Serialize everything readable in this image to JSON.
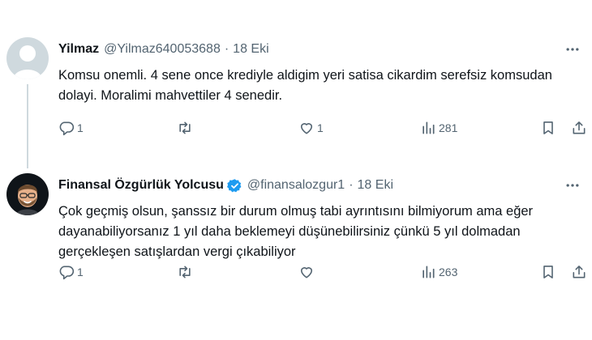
{
  "tweets": [
    {
      "author_name": "Yilmaz",
      "author_handle": "@Yilmaz640053688",
      "separator": "·",
      "date": "18 Eki",
      "verified": false,
      "text": "Komsu onemli. 4 sene once krediyle aldigim yeri satisa cikardim serefsiz komsudan dolayi. Moralimi mahvettiler 4 senedir.",
      "replies": "1",
      "retweets": "",
      "likes": "1",
      "views": "281",
      "avatar_icon": "default-user-avatar-icon"
    },
    {
      "author_name": "Finansal Özgürlük Yolcusu",
      "author_handle": "@finansalozgur1",
      "separator": "·",
      "date": "18 Eki",
      "verified": true,
      "verified_color": "#1d9bf0",
      "text": "Çok geçmiş olsun, şanssız bir durum olmuş tabi ayrıntısını bilmiyorum ama eğer dayanabiliyorsanız 1 yıl daha beklemeyi düşünebilirsiniz çünkü 5 yıl dolmadan gerçekleşen satışlardan vergi çıkabiliyor",
      "replies": "1",
      "retweets": "",
      "likes": "",
      "views": "263",
      "avatar_icon": "memoji-avatar-icon"
    }
  ],
  "icons": {
    "reply": "reply-icon",
    "retweet": "retweet-icon",
    "like": "heart-icon",
    "views": "views-chart-icon",
    "bookmark": "bookmark-icon",
    "share": "share-icon",
    "more": "more-icon"
  },
  "colors": {
    "text_primary": "#0f1419",
    "text_secondary": "#536471",
    "thread_line": "#cfd9de",
    "verified": "#1d9bf0"
  }
}
